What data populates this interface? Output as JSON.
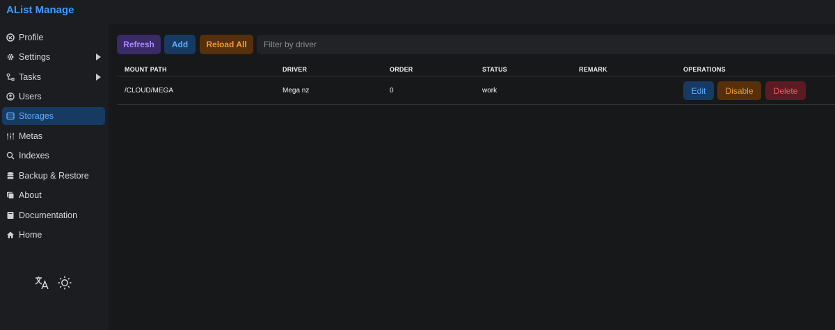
{
  "app": {
    "title": "AList Manage"
  },
  "sidebar": {
    "items": [
      {
        "label": "Profile",
        "icon": "profile-icon"
      },
      {
        "label": "Settings",
        "icon": "gear-icon",
        "expandable": true
      },
      {
        "label": "Tasks",
        "icon": "tasks-icon",
        "expandable": true
      },
      {
        "label": "Users",
        "icon": "user-circle-icon"
      },
      {
        "label": "Storages",
        "icon": "storage-icon",
        "active": true
      },
      {
        "label": "Metas",
        "icon": "sliders-icon"
      },
      {
        "label": "Indexes",
        "icon": "search-icon"
      },
      {
        "label": "Backup & Restore",
        "icon": "database-icon"
      },
      {
        "label": "About",
        "icon": "about-icon"
      },
      {
        "label": "Documentation",
        "icon": "book-icon"
      },
      {
        "label": "Home",
        "icon": "home-icon"
      }
    ],
    "tools": [
      {
        "icon": "translate-icon"
      },
      {
        "icon": "sun-icon"
      }
    ]
  },
  "toolbar": {
    "refresh_label": "Refresh",
    "add_label": "Add",
    "reload_all_label": "Reload All",
    "filter_placeholder": "Filter by driver"
  },
  "table": {
    "columns": [
      "MOUNT PATH",
      "DRIVER",
      "ORDER",
      "STATUS",
      "REMARK",
      "OPERATIONS"
    ],
    "rows": [
      {
        "mount_path": "/CLOUD/MEGA",
        "driver": "Mega nz",
        "order": "0",
        "status": "work",
        "remark": "",
        "operations": {
          "edit": "Edit",
          "disable": "Disable",
          "delete": "Delete"
        }
      }
    ]
  },
  "colors": {
    "accent": "#3b9aff",
    "refresh": "#a98bff",
    "reload": "#f59a2a",
    "danger": "#f2585e",
    "background": "#17181a",
    "sidebar": "#1c1d20"
  }
}
